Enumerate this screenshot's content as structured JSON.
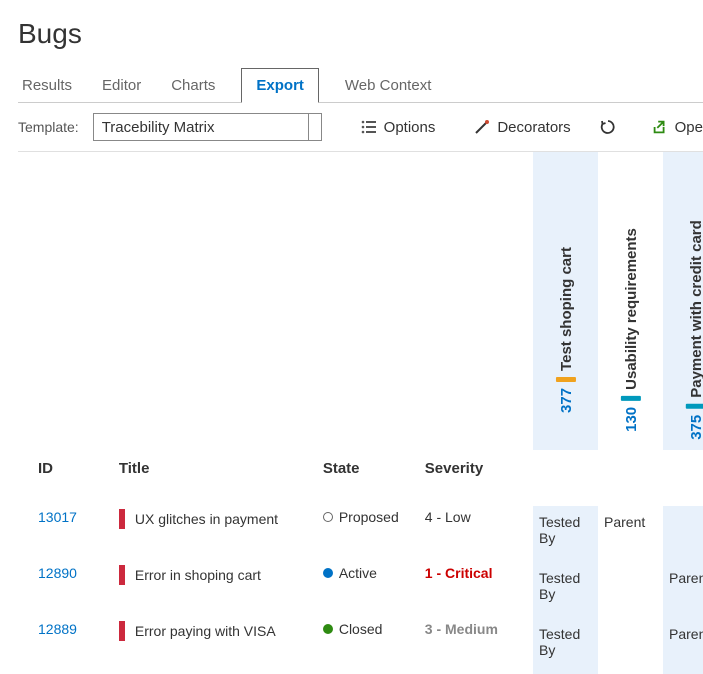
{
  "page_title": "Bugs",
  "tabs": [
    {
      "label": "Results",
      "active": false
    },
    {
      "label": "Editor",
      "active": false
    },
    {
      "label": "Charts",
      "active": false
    },
    {
      "label": "Export",
      "active": true
    },
    {
      "label": "Web Context",
      "active": false
    }
  ],
  "toolbar": {
    "template_label": "Template:",
    "template_value": "Tracebility Matrix",
    "options_label": "Options",
    "decorators_label": "Decorators",
    "open_label": "Ope"
  },
  "columns": {
    "id": "ID",
    "title": "Title",
    "state": "State",
    "severity": "Severity"
  },
  "vert_headers": [
    {
      "id": "377",
      "bar_color": "#f0a21e",
      "label": "Test shoping cart",
      "hl": true
    },
    {
      "id": "130",
      "bar_color": "#0099bc",
      "label": "Usability requirements",
      "hl": false
    },
    {
      "id": "375",
      "bar_color": "#0099bc",
      "label": "Payment with credit card",
      "hl": true
    }
  ],
  "rows": [
    {
      "id": "13017",
      "title": "UX glitches in payment",
      "state": "Proposed",
      "state_key": "proposed",
      "severity": "4 - Low",
      "sev_class": "sev-low",
      "cells": [
        "Tested By",
        "Parent",
        ""
      ]
    },
    {
      "id": "12890",
      "title": "Error in shoping cart",
      "state": "Active",
      "state_key": "active",
      "severity": "1 - Critical",
      "sev_class": "sev-crit",
      "cells": [
        "Tested By",
        "",
        "Parent"
      ]
    },
    {
      "id": "12889",
      "title": "Error paying with VISA",
      "state": "Closed",
      "state_key": "closed",
      "severity": "3 - Medium",
      "sev_class": "sev-med",
      "cells": [
        "Tested By",
        "",
        "Parent"
      ]
    }
  ]
}
